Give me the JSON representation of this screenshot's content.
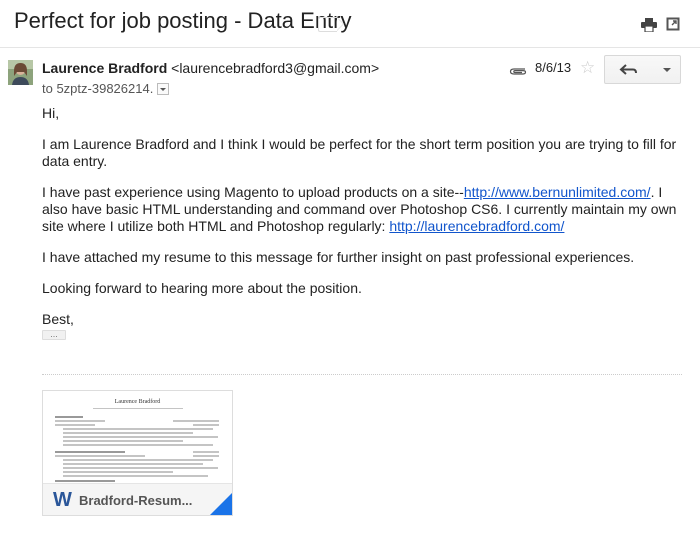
{
  "subject": "Perfect for job posting - Data Entry",
  "icons": {
    "label": "label-tag-icon",
    "print": "print-icon",
    "popout": "new-window-icon",
    "attachment": "paperclip-icon",
    "star": "star-icon",
    "reply": "reply-icon",
    "more": "chevron-down-icon",
    "word": "word-doc-icon"
  },
  "message": {
    "sender_name": "Laurence Bradford",
    "sender_email": "<laurencebradford3@gmail.com>",
    "recipient": "to 5zptz-39826214.",
    "date": "8/6/13",
    "star": "☆"
  },
  "body": {
    "greeting": "Hi,",
    "p1": "I am Laurence Bradford and I think I would be perfect for the short term position you are trying to fill for data entry.",
    "p2_a": "I have past experience using Magento to upload products on a site--",
    "p2_link1": "http://www.bernunlimited.com/",
    "p2_b": ". I also have basic HTML understanding and command over Photoshop CS6. I currently maintain my own site where I utilize both HTML and Photoshop regularly: ",
    "p2_link2": "http://laurencebradford.com/",
    "p3": "I have attached my resume to this message for further insight on past professional experiences.",
    "p4": "Looking forward to hearing more about the position.",
    "closing": "Best,",
    "trimmed": "..."
  },
  "attachment": {
    "filename": "Bradford-Resum...",
    "preview_title": "Laurence Bradford",
    "word_glyph": "W"
  },
  "colors": {
    "link": "#1155cc",
    "word_blue": "#2a5699",
    "corner_blue": "#1a73e8"
  }
}
